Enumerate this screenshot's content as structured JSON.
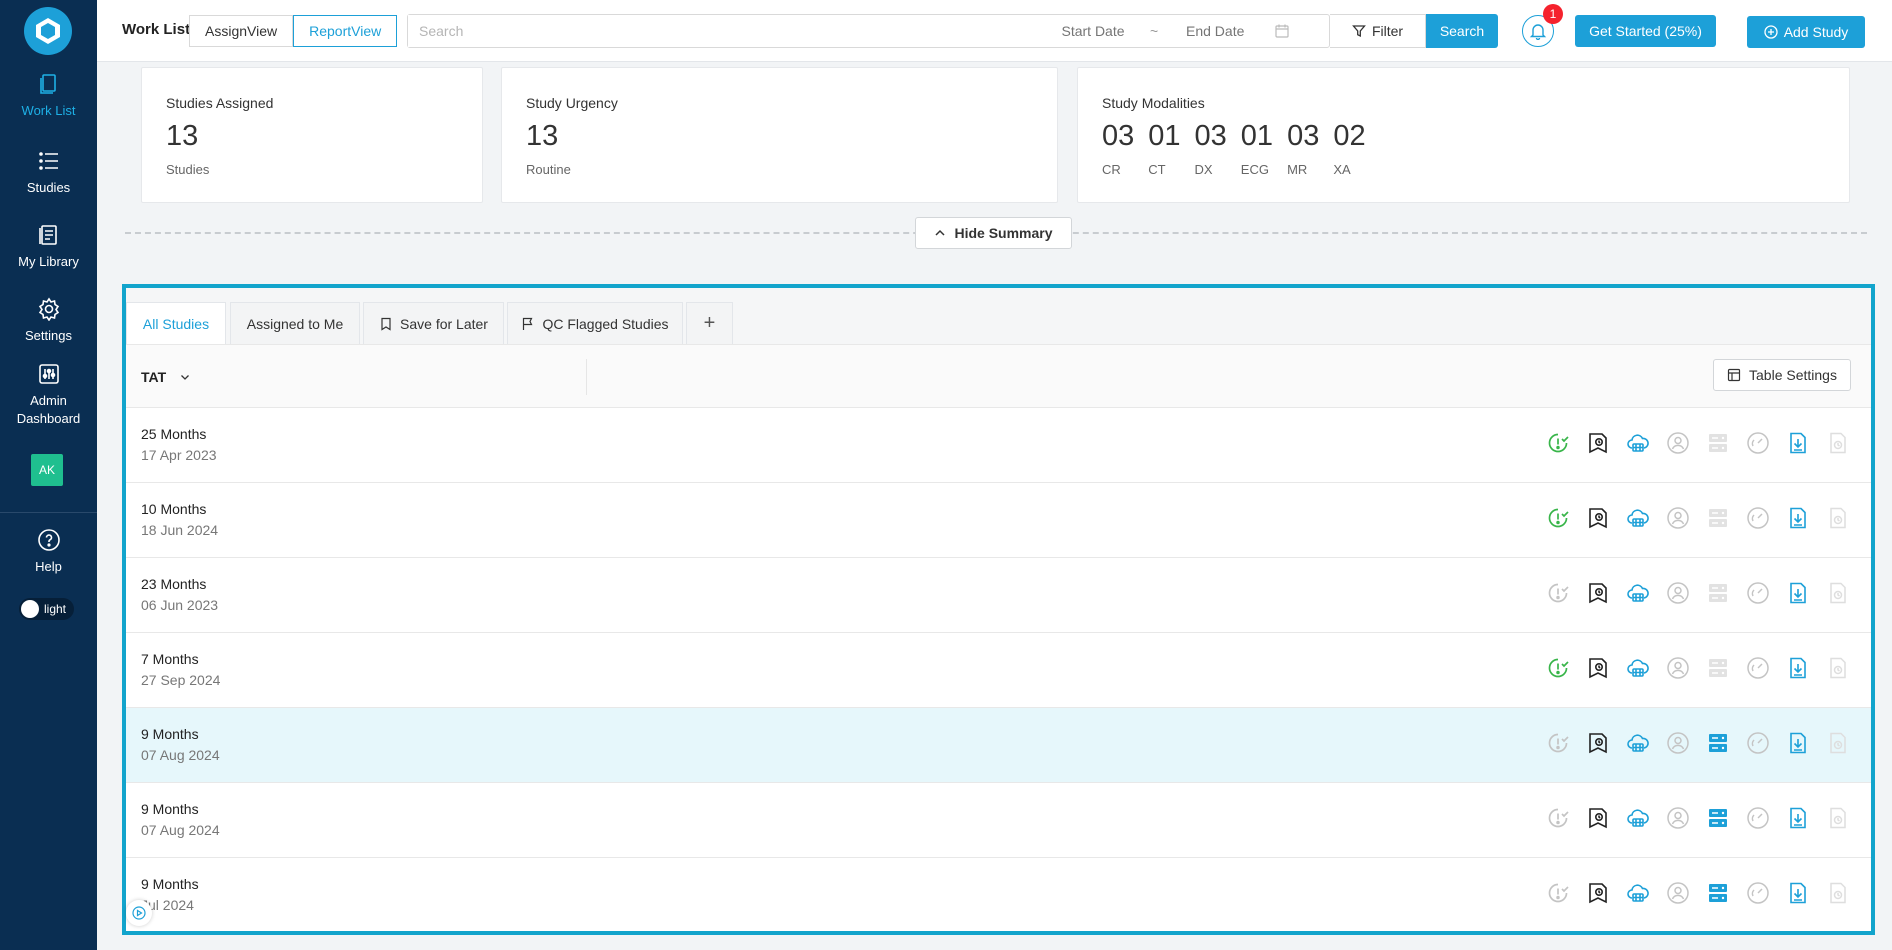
{
  "sidebar": {
    "items": [
      {
        "label": "Work List",
        "icon": "worklist-icon"
      },
      {
        "label": "Studies",
        "icon": "list-icon"
      },
      {
        "label": "My Library",
        "icon": "library-icon"
      },
      {
        "label": "Settings",
        "icon": "gear-icon"
      },
      {
        "label": "Admin Dashboard",
        "icon": "sliders-icon"
      }
    ],
    "avatar": "AK",
    "help": "Help",
    "theme": "light"
  },
  "header": {
    "title": "Work List",
    "views": [
      "AssignView",
      "ReportView"
    ],
    "active_view": "ReportView",
    "search_placeholder": "Search",
    "start_date_placeholder": "Start Date",
    "date_separator": "~",
    "end_date_placeholder": "End Date",
    "filter_label": "Filter",
    "search_label": "Search",
    "notification_count": "1",
    "get_started_label": "Get Started (25%)",
    "add_study_label": "Add Study"
  },
  "summary": {
    "assigned": {
      "title": "Studies Assigned",
      "value": "13",
      "sub": "Studies"
    },
    "urgency": {
      "title": "Study Urgency",
      "value": "13",
      "sub": "Routine"
    },
    "modalities": {
      "title": "Study Modalities",
      "items": [
        {
          "count": "03",
          "code": "CR"
        },
        {
          "count": "01",
          "code": "CT"
        },
        {
          "count": "03",
          "code": "DX"
        },
        {
          "count": "01",
          "code": "ECG"
        },
        {
          "count": "03",
          "code": "MR"
        },
        {
          "count": "02",
          "code": "XA"
        }
      ]
    },
    "hide_label": "Hide Summary"
  },
  "tabs": [
    {
      "label": "All Studies",
      "icon": ""
    },
    {
      "label": "Assigned to Me",
      "icon": ""
    },
    {
      "label": "Save for Later",
      "icon": "bookmark-icon"
    },
    {
      "label": "QC Flagged Studies",
      "icon": "flag-icon"
    },
    {
      "label": "+",
      "icon": "plus-icon"
    }
  ],
  "table": {
    "tat_header": "TAT",
    "settings_label": "Table Settings",
    "rows": [
      {
        "tat": "25 Months",
        "date": "17 Apr 2023",
        "status_green": true,
        "server_active": false,
        "selected": false
      },
      {
        "tat": "10 Months",
        "date": "18 Jun 2024",
        "status_green": true,
        "server_active": false,
        "selected": false
      },
      {
        "tat": "23 Months",
        "date": "06 Jun 2023",
        "status_green": false,
        "server_active": false,
        "selected": false
      },
      {
        "tat": "7 Months",
        "date": "27 Sep 2024",
        "status_green": true,
        "server_active": false,
        "selected": false
      },
      {
        "tat": "9 Months",
        "date": "07 Aug 2024",
        "status_green": false,
        "server_active": true,
        "selected": true
      },
      {
        "tat": "9 Months",
        "date": "07 Aug 2024",
        "status_green": false,
        "server_active": true,
        "selected": false
      },
      {
        "tat": "9 Months",
        "date": "Jul 2024",
        "status_green": false,
        "server_active": true,
        "selected": false
      }
    ]
  },
  "colors": {
    "sidebar": "#0a2e52",
    "accent": "#1da0d8",
    "green": "#39b54a",
    "grey_icon": "#c4c4c4"
  }
}
